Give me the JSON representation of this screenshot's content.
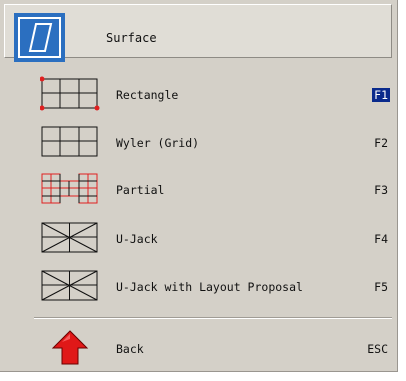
{
  "header": {
    "title": "Surface",
    "icon": "surface-parallelogram-icon"
  },
  "items": [
    {
      "label": "Rectangle",
      "key": "F1",
      "icon": "rectangle-grid-icon",
      "selected": true
    },
    {
      "label": "Wyler (Grid)",
      "key": "F2",
      "icon": "wyler-grid-icon",
      "selected": false
    },
    {
      "label": "Partial",
      "key": "F3",
      "icon": "partial-grid-icon",
      "selected": false
    },
    {
      "label": "U-Jack",
      "key": "F4",
      "icon": "ujack-icon",
      "selected": false
    },
    {
      "label": "U-Jack with Layout Proposal",
      "key": "F5",
      "icon": "ujack-layout-icon",
      "selected": false
    }
  ],
  "back": {
    "label": "Back",
    "key": "ESC",
    "icon": "up-arrow-icon"
  },
  "colors": {
    "accent": "#2b6fc0",
    "selection": "#0a2a8c",
    "marker": "#e02020",
    "back_arrow": "#e01818"
  }
}
